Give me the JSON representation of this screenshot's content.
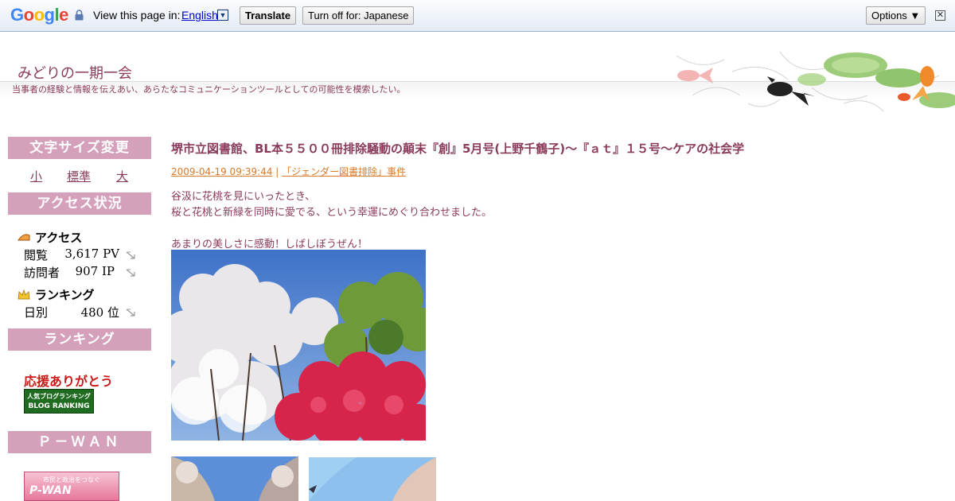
{
  "translate_bar": {
    "logo": "Google",
    "view_text": "View this page in:",
    "language": "English",
    "translate_button": "Translate",
    "turn_off_button": "Turn off for: Japanese",
    "options_button": "Options ▼"
  },
  "header": {
    "title": "みどりの一期一会",
    "description": "当事者の経験と情報を伝えあい、あらたなコミュニケーションツールとしての可能性を模索したい。"
  },
  "sidebar": {
    "font_size": {
      "heading": "文字サイズ変更",
      "small": "小",
      "standard": "標準",
      "large": "大"
    },
    "access": {
      "heading": "アクセス状況",
      "access_label": "アクセス",
      "views_label": "閲覧",
      "views_value": "3,617 PV",
      "visitors_label": "訪問者",
      "visitors_value": "907 IP",
      "ranking_label": "ランキング",
      "daily_label": "日別",
      "daily_value": "480 位"
    },
    "ranking": {
      "heading": "ランキング",
      "thanks": "応援ありがとう",
      "banner_line1": "人気ブログランキング",
      "banner_line2": "BLOG RANKING"
    },
    "pwan": {
      "heading": "Ｐ－ＷＡＮ",
      "banner_line1": "市民と政治をつなぐ",
      "banner_line2": "P-WAN"
    }
  },
  "post": {
    "title": "堺市立図書館、BL本５５００冊排除騒動の顛末『創』5月号(上野千鶴子)～『ａｔ』１５号～ケアの社会学",
    "date": "2009-04-19 09:39:44",
    "separator": " | ",
    "category": "「ジェンダー図書排除」事件",
    "line1": "谷汲に花桃を見にいったとき、",
    "line2": "桜と花桃と新緑を同時に愛でる、という幸運にめぐり合わせました。",
    "line3": "あまりの美しさに感動！しばしぼうぜん！"
  },
  "colors": {
    "accent": "#8a3a5a",
    "sidebar_heading_bg": "#d4a0ba",
    "meta_orange": "#d97a2a",
    "thanks_red": "#cc1a1a"
  }
}
